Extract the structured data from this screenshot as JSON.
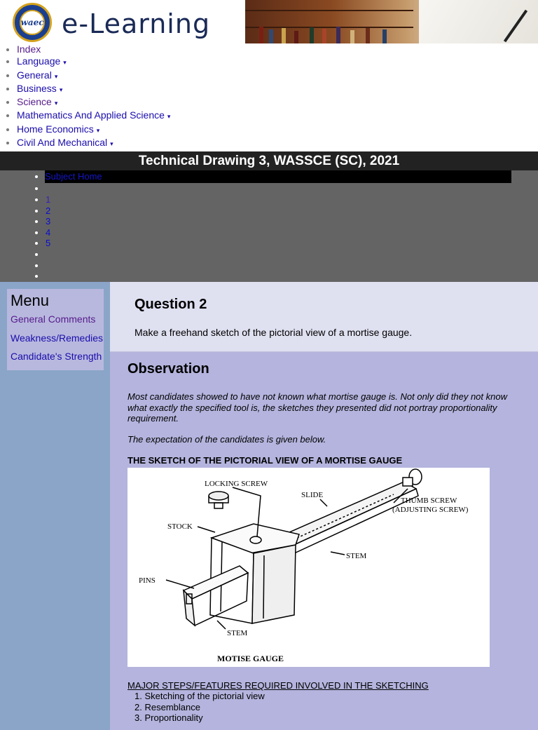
{
  "header": {
    "logo_text": "waec",
    "brand": "e-Learning"
  },
  "nav": {
    "items": [
      {
        "label": "Index",
        "caret": false,
        "visited": true
      },
      {
        "label": "Language",
        "caret": true,
        "visited": false
      },
      {
        "label": "General",
        "caret": true,
        "visited": false
      },
      {
        "label": "Business",
        "caret": true,
        "visited": false
      },
      {
        "label": "Science",
        "caret": true,
        "visited": true
      },
      {
        "label": "Mathematics And Applied Science",
        "caret": true,
        "visited": false
      },
      {
        "label": "Home Economics",
        "caret": true,
        "visited": false
      },
      {
        "label": "Civil And Mechanical",
        "caret": true,
        "visited": false
      }
    ],
    "caret_glyph": "▾"
  },
  "title": "Technical Drawing 3, WASSCE (SC), 2021",
  "pagination": {
    "subject_home": "Subject Home",
    "pages": [
      "1",
      "2",
      "3",
      "4",
      "5"
    ]
  },
  "menu": {
    "heading": "Menu",
    "items": [
      "General Comments",
      "Weakness/Remedies",
      "Candidate's Strength"
    ]
  },
  "question": {
    "heading": "Question 2",
    "text": "Make a freehand sketch of the pictorial view of a mortise gauge."
  },
  "observation": {
    "heading": "Observation",
    "para1": "Most candidates showed to have not known what mortise gauge is. Not only did they not know what exactly the specified tool is, the sketches they presented did not portray proportionality requirement.",
    "para2": "The expectation of the candidates is given below.",
    "caption": "THE SKETCH OF THE PICTORIAL VIEW OF A MORTISE GAUGE",
    "figure": {
      "labels": {
        "locking_screw": "LOCKING SCREW",
        "slide": "SLIDE",
        "thumb_screw": "THUMB SCREW",
        "adjusting_screw": "(ADJUSTING SCREW)",
        "stock": "STOCK",
        "stem_right": "STEM",
        "pins": "PINS",
        "stem_bottom": "STEM",
        "title": "MOTISE GAUGE"
      }
    },
    "steps_title": "MAJOR STEPS/FEATURES REQUIRED INVOLVED IN THE SKETCHING",
    "steps": [
      "Sketching of the pictorial view",
      "Resemblance",
      "Proportionality"
    ]
  },
  "colors": {
    "title_bar": "#222222",
    "gray_area": "#646464",
    "left_column": "#8aa5c8",
    "menu_box": "#b8b8de",
    "question_box": "#dfe0f0",
    "observation_box": "#b4b4de"
  }
}
